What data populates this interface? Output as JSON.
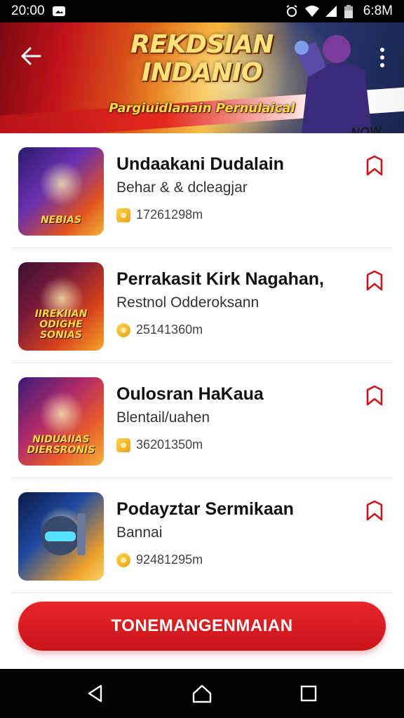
{
  "status_bar": {
    "time": "20:00",
    "clock_right": "6:8M",
    "icons": [
      "photo-icon",
      "alarm-icon",
      "wifi-icon",
      "signal-icon",
      "battery-icon"
    ]
  },
  "banner": {
    "title_line1": "REKDSIAN",
    "title_line2": "INDANIO",
    "subtitle": "Pargiuidlanain Pernulaical",
    "tag": "NOW",
    "icons": [
      "back-arrow-icon",
      "more-vertical-icon"
    ]
  },
  "items": [
    {
      "title": "Undaakani Dudalain",
      "subtitle": "Behar & & dcleagjar",
      "meta": "17261298m",
      "thumb_caption": "NEBIAS",
      "coin_shape": "square"
    },
    {
      "title": "Perrakasit Kirk Nagahan,",
      "subtitle": "Restnol Odderoksann",
      "meta": "25141360m",
      "thumb_caption": "IIREKIIAN ODIGHE SONIAS",
      "coin_shape": "round"
    },
    {
      "title": "Oulosran HaKaua",
      "subtitle": "Blentail/uahen",
      "meta": "36201350m",
      "thumb_caption": "NIDUAIIAS DIERSRONIS",
      "coin_shape": "square"
    },
    {
      "title": "Podayztar Sermikaan",
      "subtitle": "Bannai",
      "meta": "92481295m",
      "thumb_caption": "",
      "coin_shape": "round"
    }
  ],
  "cta": {
    "label": "TONEMANGENMAIAN"
  },
  "nav": {
    "icons": [
      "nav-back-icon",
      "nav-home-icon",
      "nav-recents-icon"
    ]
  },
  "colors": {
    "accent": "#d81b20",
    "bookmark": "#c8141a",
    "coin": "#f0b020"
  }
}
